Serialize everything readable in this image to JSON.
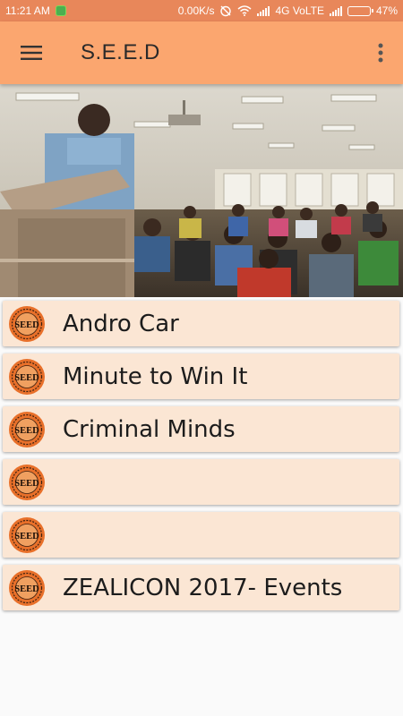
{
  "status_bar": {
    "time": "11:21 AM",
    "network_speed": "0.00K/s",
    "network_type": "4G VoLTE",
    "battery_percent": "47%",
    "battery_level": 0.47
  },
  "app_bar": {
    "title": "S.E.E.D",
    "color": "#fba66f"
  },
  "logo_text": "SEED",
  "events": [
    {
      "label": "Andro Car"
    },
    {
      "label": "Minute to Win It"
    },
    {
      "label": "Criminal Minds"
    },
    {
      "label": ""
    },
    {
      "label": ""
    },
    {
      "label": "ZEALICON 2017- Events"
    }
  ],
  "colors": {
    "status_bar": "#e8875a",
    "app_bar": "#fba66f",
    "card": "#fbe6d4",
    "logo": "#e8702a"
  }
}
